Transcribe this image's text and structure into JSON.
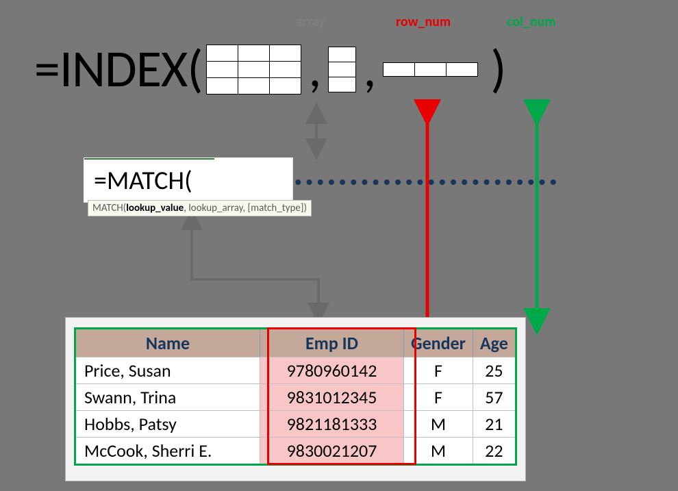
{
  "labels": {
    "array": "array",
    "row_num": "row_num",
    "col_num": "col_num"
  },
  "formula": {
    "prefix": "=INDEX("
  },
  "match": {
    "formula": "=MATCH(",
    "tooltip_plain1": "MATCH(",
    "tooltip_bold": "lookup_value",
    "tooltip_plain2": ", lookup_array, [match_type])"
  },
  "table": {
    "headers": {
      "name": "Name",
      "empid": "Emp ID",
      "gender": "Gender",
      "age": "Age"
    },
    "rows": [
      {
        "name": "Price, Susan",
        "empid": "9780960142",
        "gender": "F",
        "age": "25"
      },
      {
        "name": "Swann, Trina",
        "empid": "9831012345",
        "gender": "F",
        "age": "57"
      },
      {
        "name": "Hobbs, Patsy",
        "empid": "9821181333",
        "gender": "M",
        "age": "21"
      },
      {
        "name": "McCook, Sherri E.",
        "empid": "9830021207",
        "gender": "M",
        "age": "22"
      }
    ]
  }
}
